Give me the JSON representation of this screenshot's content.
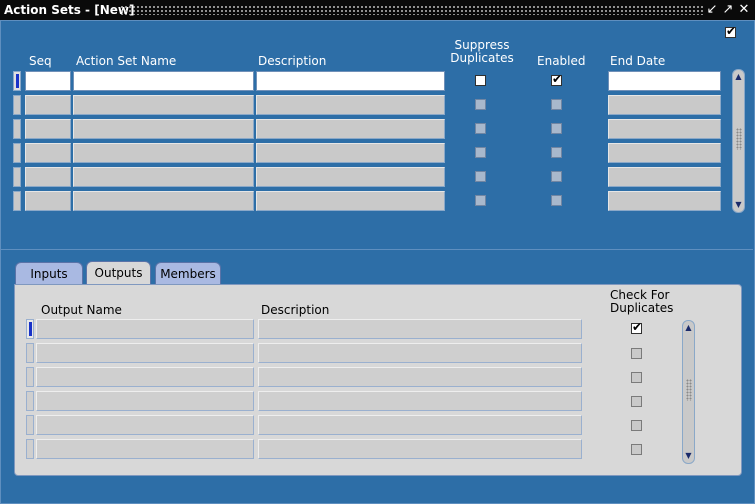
{
  "window": {
    "title": "Action Sets - [New]"
  },
  "top_checkbox": {
    "checked": true
  },
  "grid": {
    "headers": {
      "seq": "Seq",
      "name": "Action Set Name",
      "description": "Description",
      "suppress_line1": "Suppress",
      "suppress_line2": "Duplicates",
      "enabled": "Enabled",
      "end_date": "End Date"
    },
    "rows": [
      {
        "seq": "",
        "name": "",
        "description": "",
        "suppress": false,
        "enabled": true,
        "end_date": ""
      },
      {
        "seq": "",
        "name": "",
        "description": "",
        "suppress": false,
        "enabled": false,
        "end_date": ""
      },
      {
        "seq": "",
        "name": "",
        "description": "",
        "suppress": false,
        "enabled": false,
        "end_date": ""
      },
      {
        "seq": "",
        "name": "",
        "description": "",
        "suppress": false,
        "enabled": false,
        "end_date": ""
      },
      {
        "seq": "",
        "name": "",
        "description": "",
        "suppress": false,
        "enabled": false,
        "end_date": ""
      },
      {
        "seq": "",
        "name": "",
        "description": "",
        "suppress": false,
        "enabled": false,
        "end_date": ""
      }
    ]
  },
  "tabs": [
    {
      "label": "Inputs",
      "active": false
    },
    {
      "label": "Outputs",
      "active": true
    },
    {
      "label": "Members",
      "active": false
    }
  ],
  "outputs": {
    "headers": {
      "name": "Output Name",
      "description": "Description",
      "check_line1": "Check For",
      "check_line2": "Duplicates"
    },
    "rows": [
      {
        "name": "",
        "description": "",
        "check": true
      },
      {
        "name": "",
        "description": "",
        "check": false
      },
      {
        "name": "",
        "description": "",
        "check": false
      },
      {
        "name": "",
        "description": "",
        "check": false
      },
      {
        "name": "",
        "description": "",
        "check": false
      },
      {
        "name": "",
        "description": "",
        "check": false
      }
    ]
  },
  "icons": {
    "minimize": "minimize-icon",
    "restore": "restore-icon",
    "close": "close-icon",
    "scroll_up": "arrow-up-icon",
    "scroll_down": "arrow-down-icon"
  }
}
